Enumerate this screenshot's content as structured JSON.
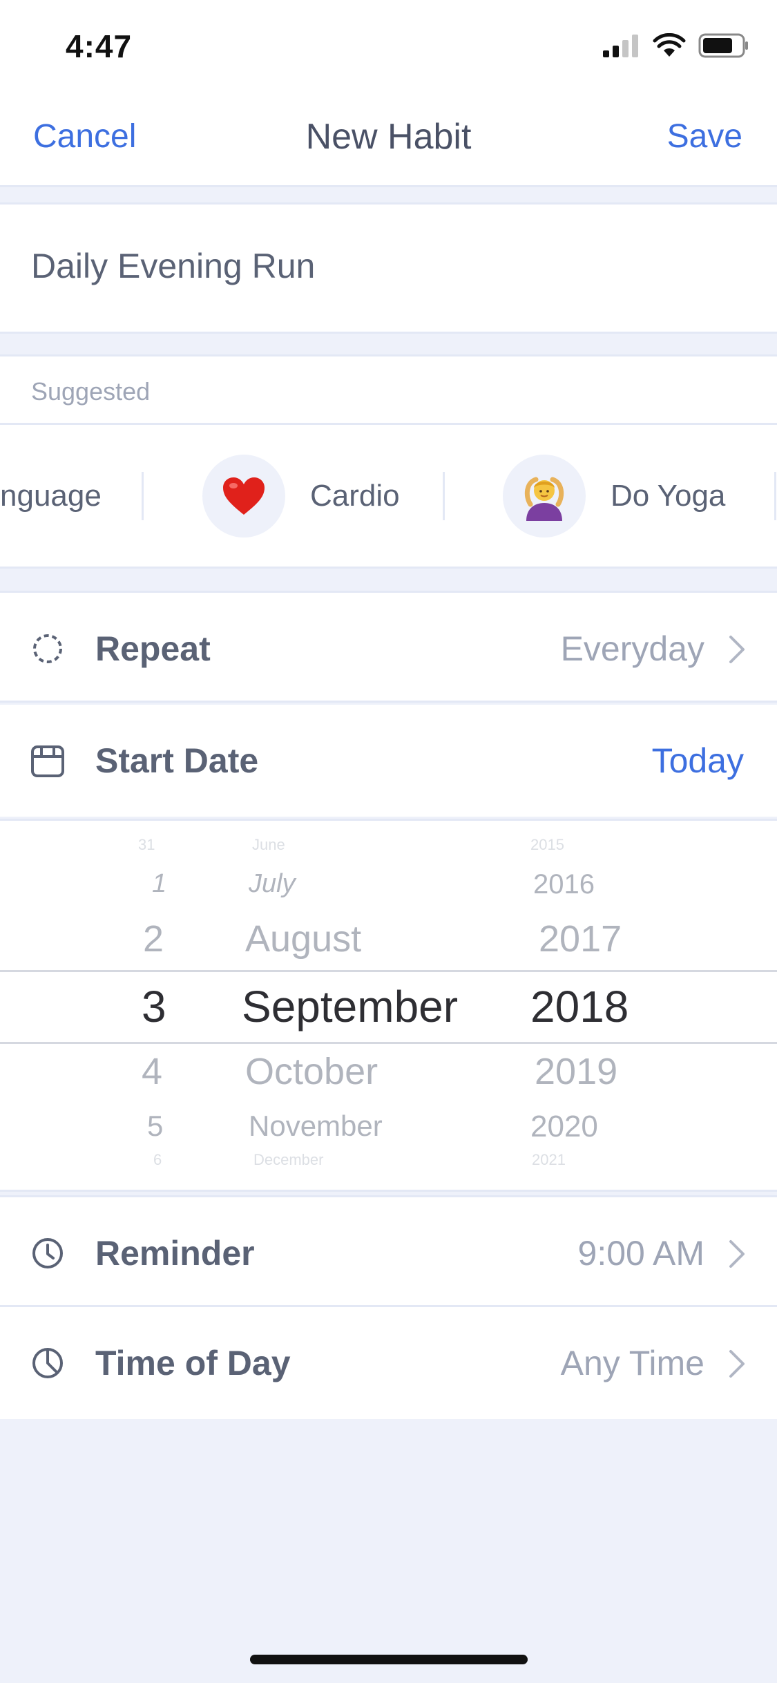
{
  "status_bar": {
    "time": "4:47"
  },
  "nav": {
    "cancel": "Cancel",
    "title": "New Habit",
    "save": "Save"
  },
  "habit_name": "Daily Evening Run",
  "suggested": {
    "header": "Suggested",
    "items": [
      {
        "label": "nguage"
      },
      {
        "label": "Cardio",
        "emoji": "❤️"
      },
      {
        "label": "Do Yoga",
        "emoji": "🙆‍♀️"
      }
    ]
  },
  "repeat": {
    "label": "Repeat",
    "value": "Everyday"
  },
  "start_date": {
    "label": "Start Date",
    "value": "Today"
  },
  "picker": {
    "days": [
      "31",
      "1",
      "2",
      "3",
      "4",
      "5",
      "6"
    ],
    "months": [
      "June",
      "July",
      "August",
      "September",
      "October",
      "November",
      "December"
    ],
    "years": [
      "2015",
      "2016",
      "2017",
      "2018",
      "2019",
      "2020",
      "2021"
    ]
  },
  "reminder": {
    "label": "Reminder",
    "value": "9:00 AM"
  },
  "time_of_day": {
    "label": "Time of Day",
    "value": "Any Time"
  },
  "colors": {
    "accent": "#3d6fe0",
    "background": "#eef1fa",
    "text": "#5a6275",
    "muted": "#9ea5b6"
  }
}
